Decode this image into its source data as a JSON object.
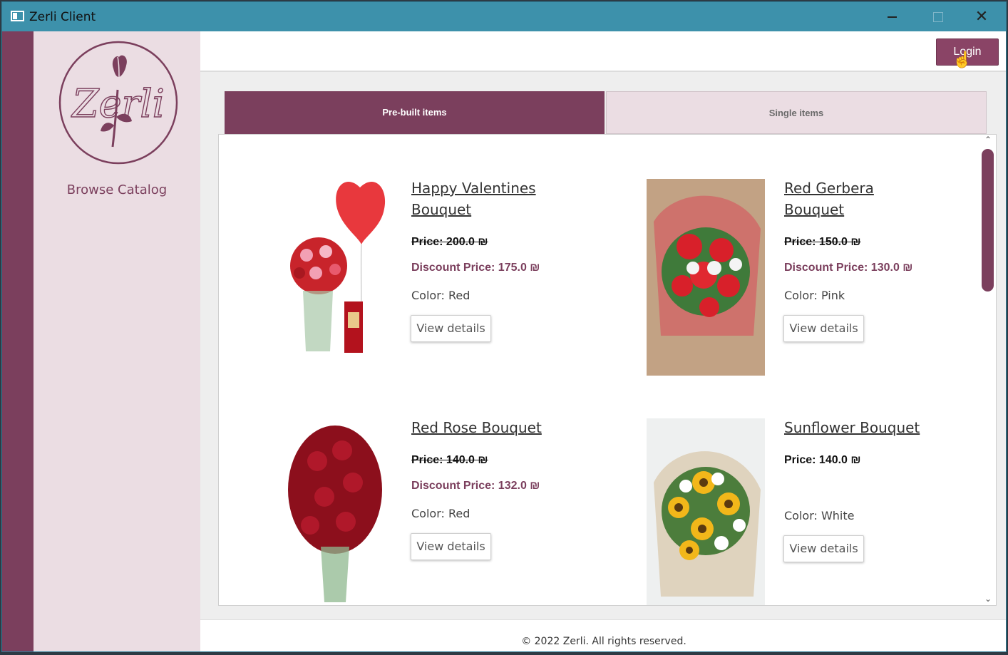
{
  "window": {
    "title": "Zerli Client",
    "minimize_icon": "minimize-icon",
    "maximize_icon": "maximize-icon",
    "close_icon": "close-icon",
    "close_glyph": "✕"
  },
  "sidebar": {
    "logo_text": "Zerli",
    "browse_label": "Browse Catalog"
  },
  "topbar": {
    "login_label": "Login"
  },
  "tabs": [
    {
      "label": "Pre-built items",
      "active": true
    },
    {
      "label": "Single items",
      "active": false
    }
  ],
  "products": [
    {
      "name_line1": "Happy Valentines",
      "name_line2": "Bouquet",
      "price": "Price: 200.0 ₪",
      "discount": "Discount Price: 175.0 ₪",
      "color": "Color: Red",
      "button": "View details"
    },
    {
      "name_line1": "Red Gerbera",
      "name_line2": "Bouquet",
      "price": "Price: 150.0 ₪",
      "discount": "Discount Price: 130.0 ₪",
      "color": "Color: Pink",
      "button": "View details"
    },
    {
      "name_line1": "Red Rose Bouquet",
      "name_line2": "",
      "price": "Price: 140.0 ₪",
      "discount": "Discount Price: 132.0 ₪",
      "color": "Color: Red",
      "button": "View details"
    },
    {
      "name_line1": "Sunflower Bouquet",
      "name_line2": "",
      "price": "Price: 140.0 ₪",
      "discount": "",
      "color": "Color: White",
      "button": "View details"
    }
  ],
  "scrollbar": {
    "up_glyph": "⌃",
    "down_glyph": "⌄"
  },
  "footer": {
    "text": "© 2022 Zerli. All rights reserved."
  },
  "colors": {
    "brand": "#7b3f5d",
    "titlebar": "#3d91ab",
    "sidebar_bg": "#ebdde3",
    "login_btn": "#8a4466"
  }
}
